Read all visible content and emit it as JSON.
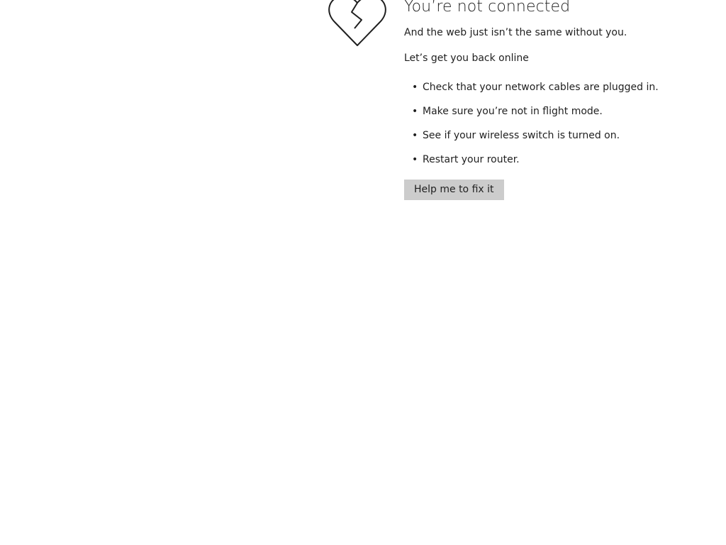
{
  "error": {
    "icon": "broken-heart-icon",
    "title": "You’re not connected",
    "subtitle": "And the web just isn’t the same without you.",
    "lead": "Let’s get you back online",
    "tips": [
      "Check that your network cables are plugged in.",
      "Make sure you’re not in flight mode.",
      "See if your wireless switch is turned on.",
      "Restart your router."
    ],
    "button_label": "Help me to fix it"
  },
  "colors": {
    "background": "#ffffff",
    "text": "#1f1f1f",
    "button_bg": "#cccccc"
  }
}
